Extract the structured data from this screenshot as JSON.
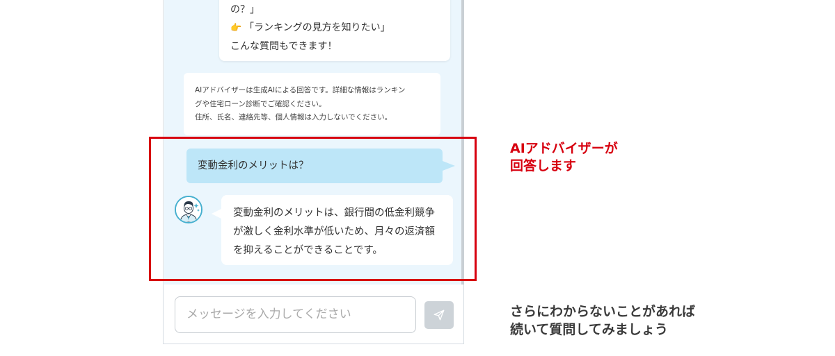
{
  "chat": {
    "intro_bubble": {
      "lines": [
        "の？」",
        "「ランキングの見方を知りたい」",
        "こんな質問もできます！"
      ],
      "pointing_icon": "backhand-index-pointing-right-icon"
    },
    "disclaimer": {
      "lines": [
        "AIアドバイザーは生成AIによる回答です。詳細な情報はランキン",
        "グや住宅ローン診断でご確認ください。",
        "住所、氏名、連絡先等、個人情報は入力しないでください。"
      ]
    },
    "user_message": "変動金利のメリットは？",
    "ai_message": {
      "lines": [
        "変動金利のメリットは、銀行間の低金利競争",
        "が激しく金利水準が低いため、月々の返済額",
        "を抑えることができることです。"
      ],
      "avatar_icon": "advisor-avatar-icon"
    },
    "input": {
      "placeholder": "メッセージを入力してください"
    },
    "send_icon": "paper-plane-icon"
  },
  "annotations": {
    "ai_answer_note": [
      "AIアドバイザーが",
      "回答します"
    ],
    "follow_up_note": [
      "さらにわからないことがあれば",
      "続いて質問してみましょう"
    ]
  },
  "colors": {
    "chat_background": "#ebf6fd",
    "user_bubble": "#bde6f8",
    "highlight_frame": "#d7000f",
    "avatar_ring": "#47b0cf",
    "send_button": "#cdd3d8"
  }
}
